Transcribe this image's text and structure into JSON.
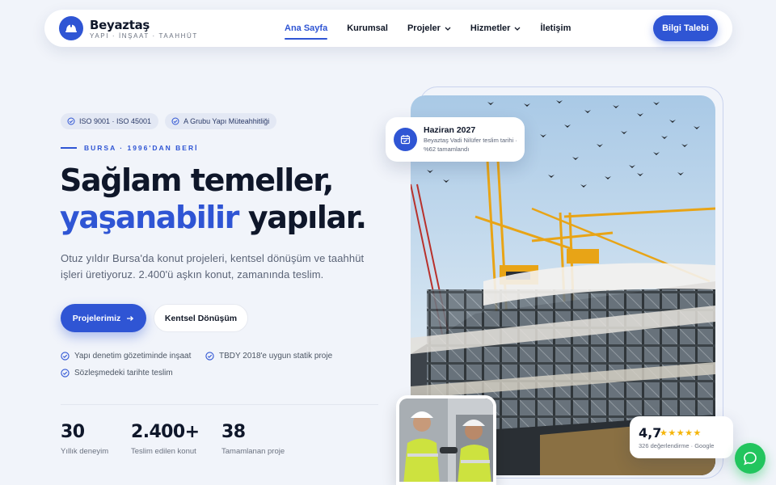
{
  "brand": {
    "name": "Beyaztaş",
    "tagline": "YAPI · İNŞAAT · TAAHHÜT",
    "logo_icon": "hard-hat-icon"
  },
  "nav": {
    "items": [
      {
        "label": "Ana Sayfa",
        "active": true
      },
      {
        "label": "Kurumsal"
      },
      {
        "label": "Projeler",
        "dropdown": true
      },
      {
        "label": "Hizmetler",
        "dropdown": true
      },
      {
        "label": "İletişim"
      }
    ],
    "cta": "Bilgi Talebi"
  },
  "hero": {
    "badges": [
      "ISO 9001 · ISO 45001",
      "A Grubu Yapı Müteahhitliği"
    ],
    "eyebrow": "BURSA · 1996'DAN BERİ",
    "title_line1": "Sağlam temeller,",
    "title_accent": "yaşanabilir",
    "title_rest": " yapılar.",
    "lead": "Otuz yıldır Bursa'da konut projeleri, kentsel dönüşüm ve taahhüt işleri üretiyoruz. 2.400'ü aşkın konut, zamanında teslim.",
    "primary_button": "Projelerimiz",
    "secondary_button": "Kentsel Dönüşüm",
    "checks": [
      "Yapı denetim gözetiminde inşaat",
      "TBDY 2018'e uygun statik proje",
      "Sözleşmedeki tarihte teslim"
    ],
    "stats": [
      {
        "value": "30",
        "label": "Yıllık deneyim"
      },
      {
        "value": "2.400+",
        "label": "Teslim edilen konut"
      },
      {
        "value": "38",
        "label": "Tamamlanan proje"
      }
    ]
  },
  "project_card": {
    "title": "Haziran 2027",
    "description": "Beyaztaş Vadi Nilüfer teslim tarihi · %62 tamamlandı",
    "icon": "calendar-icon"
  },
  "rating": {
    "value": "4,7",
    "stars": 5,
    "subtitle": "326 değerlendirme · Google"
  },
  "colors": {
    "primary": "#2f55d4",
    "background": "#f1f4fa",
    "star": "#f5b50a",
    "chat": "#22c55e"
  },
  "chat": {
    "icon": "chat-bubble-icon"
  }
}
